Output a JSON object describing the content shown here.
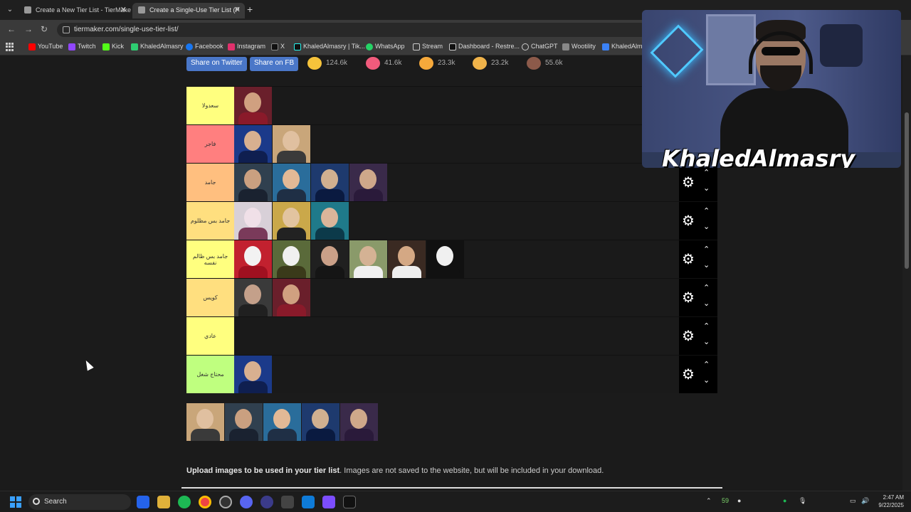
{
  "browser": {
    "tabs": [
      {
        "title": "Create a New Tier List - TierMaker",
        "active": false
      },
      {
        "title": "Create a Single-Use Tier List (P",
        "active": true
      }
    ],
    "url": "tiermaker.com/single-use-tier-list/",
    "bookmarks": [
      "YouTube",
      "Twitch",
      "Kick",
      "KhaledAlmasry",
      "Facebook",
      "Instagram",
      "X",
      "KhaledAlmasry | Tik...",
      "WhatsApp",
      "Stream",
      "Dashboard - Restre...",
      "ChatGPT",
      "Wootility",
      "KhaledAlma"
    ]
  },
  "share": {
    "twitter": "Share on Twitter",
    "fb": "Share on FB"
  },
  "reactions": [
    {
      "count": "124.6k",
      "color": "#f6c33b"
    },
    {
      "count": "41.6k",
      "color": "#f15b7c"
    },
    {
      "count": "23.3k",
      "color": "#f6a93b"
    },
    {
      "count": "23.2k",
      "color": "#f0b34a"
    },
    {
      "count": "55.6k",
      "color": "#8c5a4a"
    }
  ],
  "tiers": [
    {
      "label": "سعدولا",
      "color": "#ffff7f",
      "count": 1
    },
    {
      "label": "فاجر",
      "color": "#ff7f7f",
      "count": 2
    },
    {
      "label": "جامد",
      "color": "#ffbf7f",
      "count": 4
    },
    {
      "label": "جامد بس مظلوم",
      "color": "#ffdf7f",
      "count": 3
    },
    {
      "label": "جامد بس ظالم نفسه",
      "color": "#ffff7f",
      "count": 6
    },
    {
      "label": "كويس",
      "color": "#ffdf7f",
      "count": 2
    },
    {
      "label": "عادي",
      "color": "#ffff7f",
      "count": 0
    },
    {
      "label": "محتاج شغل",
      "color": "#bfff7f",
      "count": 1
    }
  ],
  "pool_count": 5,
  "upload": {
    "bold": "Upload images to be used in your tier list",
    "rest": ". Images are not saved to the website, but will be included in your download."
  },
  "webcam": {
    "name": "KhaledAlmasry"
  },
  "taskbar": {
    "search": "Search",
    "tray_num": "59",
    "time": "2:47 AM",
    "date": "9/22/2025"
  }
}
